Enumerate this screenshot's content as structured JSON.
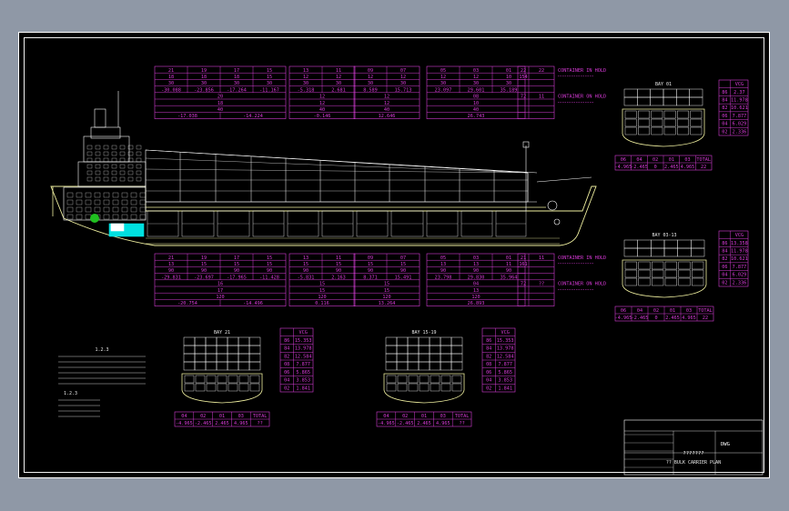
{
  "colors": {
    "background": "#8f98a6",
    "sheet": "#000000",
    "table": "#d43cd4",
    "hull": "#f0f0a0",
    "frame": "#ffffff",
    "cargo_hold": "#00e0e0",
    "accent_green": "#20c020"
  },
  "upper_table": {
    "blocks": [
      {
        "cols": [
          "21",
          "19",
          "17",
          "15"
        ],
        "r1": [
          "18",
          "18",
          "18",
          "15"
        ],
        "r2": [
          "30",
          "30",
          "30",
          "30"
        ],
        "r3": [
          "-30.088",
          "-23.856",
          "-17.264",
          "-11.167"
        ],
        "r4": "20",
        "r5": "18",
        "r6": "40",
        "r7": "-17.038",
        "r8": "-14.224"
      },
      {
        "cols": [
          "13",
          "11"
        ],
        "r1": [
          "12",
          "12"
        ],
        "r2": [
          "30",
          "30"
        ],
        "r3": [
          "-5.318",
          "2.681"
        ],
        "r4": "12",
        "r5": "12",
        "r6": "40",
        "r7": "-0.146"
      },
      {
        "cols": [
          "09",
          "07"
        ],
        "r1": [
          "12",
          "12"
        ],
        "r2": [
          "30",
          "30"
        ],
        "r3": [
          "8.589",
          "15.713"
        ],
        "r4": "12",
        "r5": "12",
        "r6": "40",
        "r7": "12.646"
      },
      {
        "cols": [
          "05",
          "03",
          "01"
        ],
        "r1": [
          "12",
          "12",
          "10"
        ],
        "r2": [
          "30",
          "30",
          "30"
        ],
        "r3": [
          "23.097",
          "29.601",
          "35.189"
        ],
        "r4": "08",
        "r5": "10",
        "r6": "40",
        "r7": "26.743"
      }
    ],
    "legend": {
      "num1": "22",
      "num2": "154",
      "num3": "72",
      "note1": "CONTAINER IN HOLD",
      "note2": "CONTAINER ON HOLD",
      "q1": "22",
      "q2": "11"
    }
  },
  "lower_table": {
    "blocks": [
      {
        "cols": [
          "21",
          "19",
          "17",
          "15"
        ],
        "r1": [
          "13",
          "15",
          "15",
          "15"
        ],
        "r2": [
          "90",
          "90",
          "90",
          "90"
        ],
        "r3": [
          "-29.831",
          "-23.697",
          "-17.965",
          "-11.428"
        ],
        "r4": "16",
        "r5": "17",
        "r6": "120",
        "r7": "-20.754",
        "r8": "-14.496"
      },
      {
        "cols": [
          "13",
          "11"
        ],
        "r1": [
          "15",
          "15"
        ],
        "r2": [
          "90",
          "90"
        ],
        "r3": [
          "-5.831",
          "2.163"
        ],
        "r4": "15",
        "r5": "15",
        "r6": "120",
        "r7": "0.116"
      },
      {
        "cols": [
          "09",
          "07"
        ],
        "r1": [
          "15",
          "15"
        ],
        "r2": [
          "90",
          "90"
        ],
        "r3": [
          "8.371",
          "15.491"
        ],
        "r4": "15",
        "r5": "15",
        "r6": "120",
        "r7": "13.264"
      },
      {
        "cols": [
          "05",
          "03",
          "01"
        ],
        "r1": [
          "13",
          "13",
          "11"
        ],
        "r2": [
          "90",
          "90",
          "90"
        ],
        "r3": [
          "23.798",
          "29.830",
          "35.964"
        ],
        "r4": "04",
        "r5": "13",
        "r6": "120",
        "r7": "26.893"
      }
    ],
    "legend": {
      "num1": "21",
      "num2": "161",
      "num3": "72",
      "note1": "CONTAINER IN HOLD",
      "note2": "CONTAINER ON HOLD",
      "q1": "11",
      "q2": "??"
    }
  },
  "bays": {
    "bay01": {
      "title": "BAY 01",
      "vcg_header": "VCG",
      "vcg": [
        "2.37",
        "11.978",
        "10.621",
        "7.877",
        "6.029",
        "2.336"
      ],
      "tiers": [
        "86",
        "84",
        "82",
        "06",
        "04",
        "02"
      ],
      "bottom_cols": [
        "06",
        "04",
        "02",
        "01",
        "03",
        "TOTAL"
      ],
      "bottom_vals": [
        "-4.965",
        "-2.465",
        "0",
        "2.465",
        "4.965",
        "22"
      ]
    },
    "bay0313": {
      "title": "BAY 03-13",
      "vcg_header": "VCG",
      "vcg": [
        "13.358",
        "11.978",
        "10.621",
        "7.877",
        "6.029",
        "2.336"
      ],
      "tiers": [
        "86",
        "84",
        "82",
        "06",
        "04",
        "02"
      ],
      "bottom_cols": [
        "06",
        "04",
        "02",
        "01",
        "03",
        "TOTAL"
      ],
      "bottom_vals": [
        "-4.965",
        "-2.465",
        "0",
        "2.465",
        "4.965",
        "22"
      ]
    },
    "bay21": {
      "title": "BAY 21",
      "vcg_header": "VCG",
      "vcg": [
        "15.353",
        "13.978",
        "12.584",
        "7.877",
        "5.865",
        "3.853",
        "1.841"
      ],
      "tiers": [
        "86",
        "84",
        "82",
        "08",
        "06",
        "04",
        "02"
      ],
      "bottom_cols": [
        "04",
        "02",
        "01",
        "03",
        "TOTAL"
      ],
      "bottom_vals": [
        "-4.965",
        "-2.465",
        "2.465",
        "4.965",
        "??"
      ]
    },
    "bay1519": {
      "title": "BAY 15-19",
      "vcg_header": "VCG",
      "vcg": [
        "15.353",
        "13.978",
        "12.584",
        "7.877",
        "5.865",
        "3.853",
        "1.841"
      ],
      "tiers": [
        "86",
        "84",
        "82",
        "08",
        "06",
        "04",
        "02"
      ],
      "bottom_cols": [
        "04",
        "02",
        "01",
        "03",
        "TOTAL"
      ],
      "bottom_vals": [
        "-4.965",
        "-2.465",
        "2.465",
        "4.965",
        "??"
      ]
    }
  },
  "notes": {
    "heading1": "1.2.3",
    "heading2": "1.2.3"
  },
  "title_block": {
    "project": "DWG",
    "caption": "???????",
    "subcaption": "?? BULK CARRIER PLAN"
  }
}
